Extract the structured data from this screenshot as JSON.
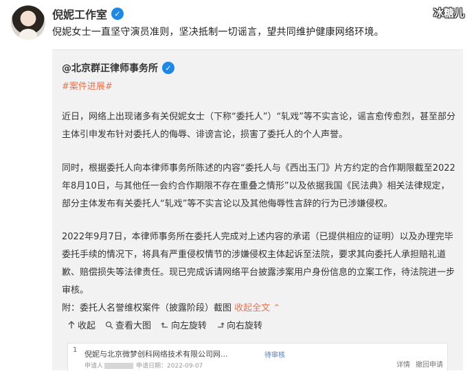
{
  "post": {
    "author": "倪妮工作室",
    "verified_icon": "verified-badge-icon",
    "text": "倪妮女士一直坚守演员准则，坚决抵制一切谣言，望共同维护健康网络环境。",
    "watermark": "冰糖儿"
  },
  "repost": {
    "author": "@北京群正律师事务所",
    "tag": "#案件进展#",
    "paragraphs": [
      "近日，网络上出现诸多有关倪妮女士（下称“委托人”）“轧戏”等不实言论，谣言愈传愈烈，甚至部分主体引申发布针对委托人的侮辱、诽谤言论，损害了委托人的个人声誉。",
      "同时，根据委托人向本律师事务所陈述的内容“委托人与《西出玉门》片方约定的合作期限截至2022年8月10日，与其他任一会约合作期限不存在重叠之情形”以及依据我国《民法典》相关法律规定，部分主体发布有关委托人“轧戏”等不实言论以及其他侮辱性言辞的行为已涉嫌侵权。",
      "2022年9月7日，本律师事务所在委托人完成对上述内容的承诺（已提供相应的证明）以及办理完毕委托手续的情况下，将具有严重侵权情节的涉嫌侵权主体起诉至法院，要求其向委托人承担赔礼道歉、赔偿损失等法律责任。现已完成诉请网络平台披露涉案用户身份信息的立案工作，待法院进一步审核。"
    ],
    "attachment_label": "附：委托人名誉维权案件（披露阶段）截图",
    "collapse_label": "收起全文",
    "collapse_icon": "chevron-up-icon",
    "toolbar": {
      "collapse": "收起",
      "view_large": "查看大图",
      "rotate_left": "向左旋转",
      "rotate_right": "向右旋转"
    },
    "embed": {
      "number": "1",
      "title": "倪妮与北京微梦创科网络技术有限公司网...",
      "status": "待审核",
      "applicant_label": "申请人",
      "date_label": "申请日期：2022-09-07",
      "actions": [
        "详情",
        "撤回申请"
      ]
    }
  }
}
